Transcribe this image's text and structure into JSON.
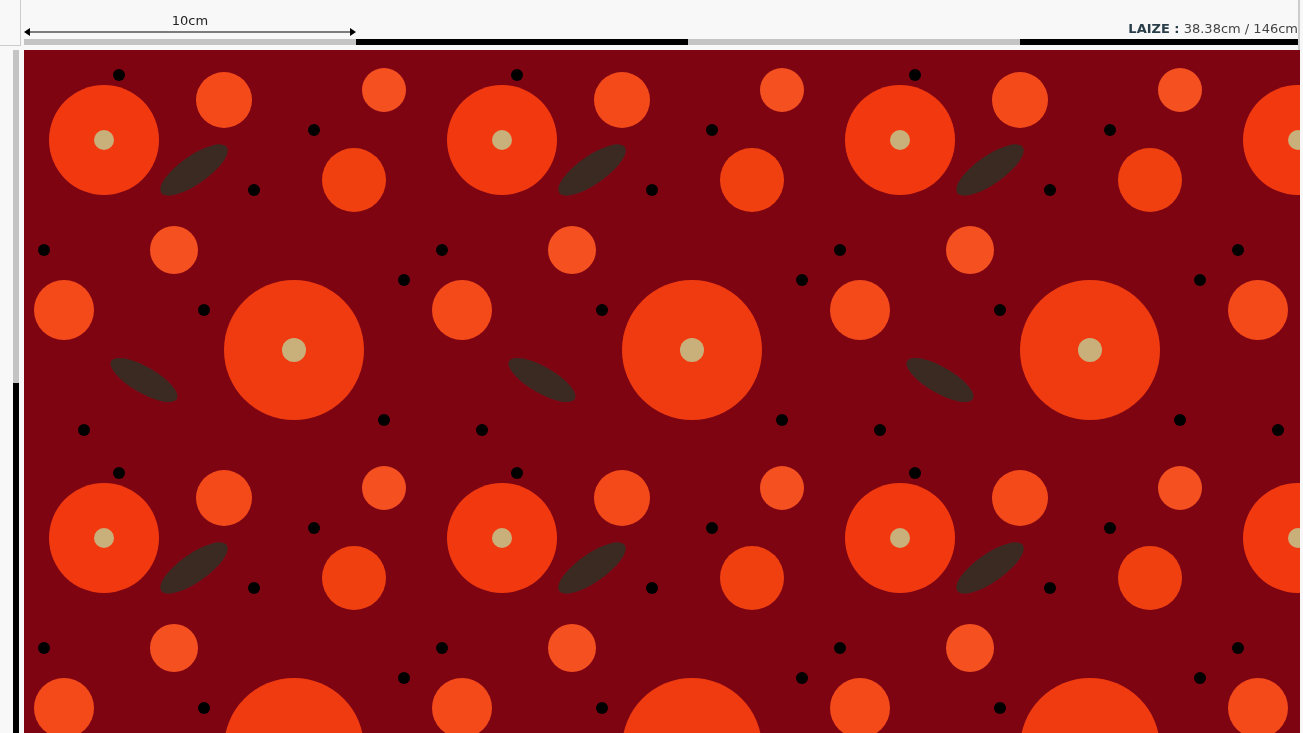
{
  "ruler": {
    "label": "10cm"
  },
  "width_info": {
    "label": "LAIZE :",
    "value": "38.38cm / 146cm"
  }
}
